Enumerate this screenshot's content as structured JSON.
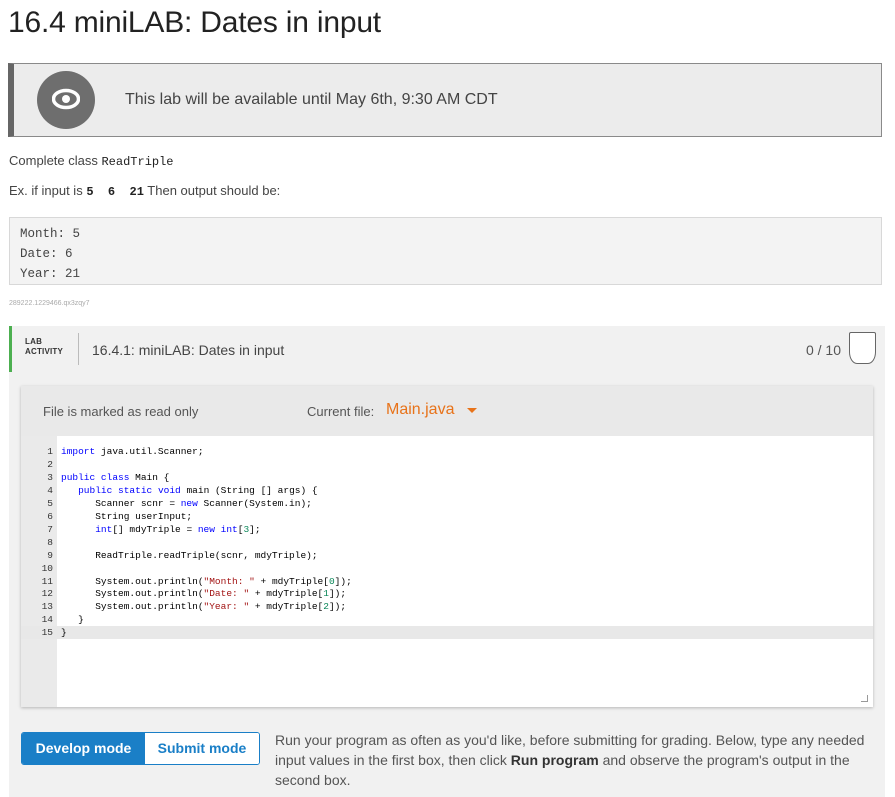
{
  "page": {
    "title": "16.4 miniLAB: Dates in input"
  },
  "banner": {
    "icon": "eye-icon",
    "text": "This lab will be available until May 6th, 9:30 AM CDT"
  },
  "instructions": {
    "complete_prefix": "Complete class ",
    "complete_class": "ReadTriple",
    "example_prefix": "Ex. if input is ",
    "example_input": "5 6 21",
    "example_suffix": " Then output should be:"
  },
  "sample_output": [
    "Month: 5",
    "Date: 6",
    "Year: 21"
  ],
  "tracking_id": "289222.1229466.qx3zqy7",
  "lab": {
    "tag_line1": "LAB",
    "tag_line2": "ACTIVITY",
    "title": "16.4.1: miniLAB: Dates in input",
    "score": "0 / 10"
  },
  "editor": {
    "readonly_label": "File is marked as read only",
    "current_file_label": "Current file:",
    "current_file": "Main.java",
    "lines": [
      "import java.util.Scanner;",
      "",
      "public class Main {",
      "   public static void main (String [] args) {",
      "      Scanner scnr = new Scanner(System.in);",
      "      String userInput;",
      "      int[] mdyTriple = new int[3];",
      "",
      "      ReadTriple.readTriple(scnr, mdyTriple);",
      "",
      "      System.out.println(\"Month: \" + mdyTriple[0]);",
      "      System.out.println(\"Date: \" + mdyTriple[1]);",
      "      System.out.println(\"Year: \" + mdyTriple[2]);",
      "   }",
      "}"
    ]
  },
  "modes": {
    "develop": "Develop mode",
    "submit": "Submit mode"
  },
  "run_help": {
    "part1": "Run your program as often as you'd like, before submitting for grading. Below, type any needed input values in the first box, then click ",
    "run_label": "Run program",
    "part2": " and observe the program's output in the second box."
  }
}
